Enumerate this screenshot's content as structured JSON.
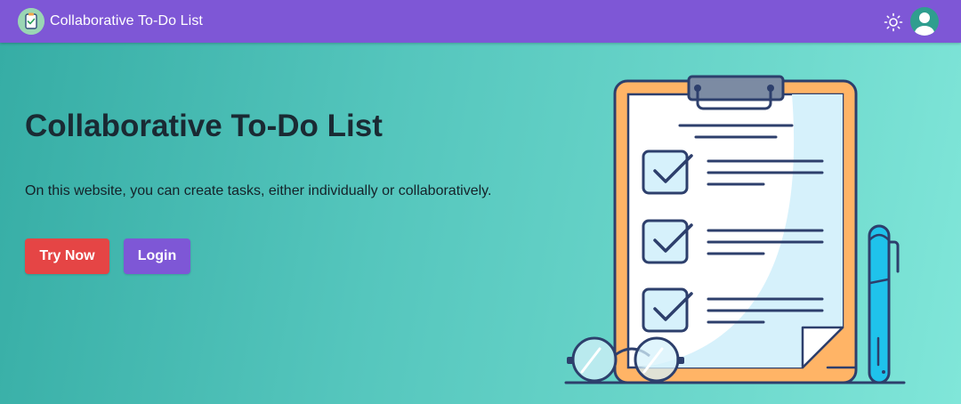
{
  "navbar": {
    "brand_title": "Collaborative To-Do List",
    "logo_icon": "clipboard-check-icon",
    "theme_icon": "sun-icon",
    "avatar_icon": "user-avatar-icon"
  },
  "hero": {
    "title": "Collaborative To-Do List",
    "subtitle": "On this website, you can create tasks, either individually or collaboratively.",
    "try_label": "Try Now",
    "login_label": "Login",
    "illustration": "clipboard-checklist-illustration"
  },
  "colors": {
    "navbar": "#7e57d6",
    "try_button": "#e54545",
    "login_button": "#7e57d6",
    "hero_gradient_start": "#36ada5",
    "hero_gradient_end": "#80e6d9"
  }
}
